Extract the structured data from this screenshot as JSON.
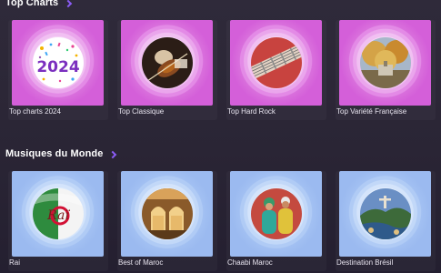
{
  "sections": [
    {
      "title": "Top Charts",
      "cards": [
        {
          "label": "Top charts 2024",
          "art_text": "2024"
        },
        {
          "label": "Top Classique"
        },
        {
          "label": "Top Hard Rock"
        },
        {
          "label": "Top Variété Française"
        }
      ]
    },
    {
      "title": "Musiques du Monde",
      "cards": [
        {
          "label": "Rai",
          "art_text": "Raï"
        },
        {
          "label": "Best of Maroc"
        },
        {
          "label": "Chaabi Maroc"
        },
        {
          "label": "Destination Brésil"
        }
      ]
    }
  ],
  "colors": {
    "accent": "#8b5cf6",
    "tile_pink": "#e38ae6",
    "tile_blue": "#b0cbf5"
  }
}
